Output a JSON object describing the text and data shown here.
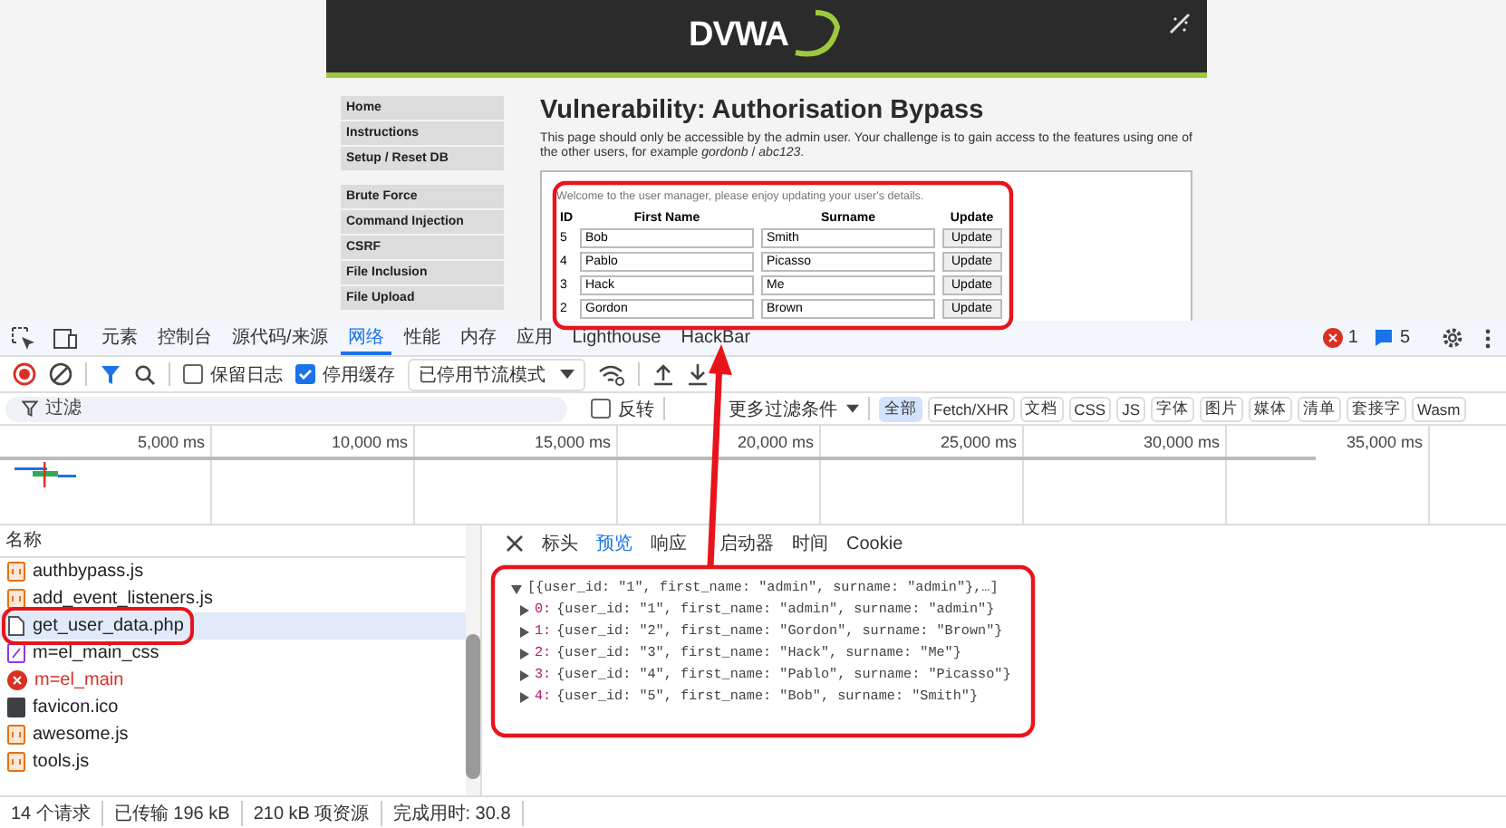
{
  "page": {
    "logo": "DVWA",
    "menu_groups": [
      [
        "Home",
        "Instructions",
        "Setup / Reset DB"
      ],
      [
        "Brute Force",
        "Command Injection",
        "CSRF",
        "File Inclusion",
        "File Upload"
      ]
    ],
    "heading": "Vulnerability: Authorisation Bypass",
    "intro": "This page should only be accessible by the admin user. Your challenge is to gain access to the features using one of the other users, for example *gordonb* / *abc123*.",
    "welcome": "Welcome to the user manager, please enjoy updating your user's details.",
    "columns": [
      "ID",
      "First Name",
      "Surname",
      "Update"
    ],
    "rows": [
      {
        "id": "5",
        "first_name": "Bob",
        "surname": "Smith",
        "button": "Update"
      },
      {
        "id": "4",
        "first_name": "Pablo",
        "surname": "Picasso",
        "button": "Update"
      },
      {
        "id": "3",
        "first_name": "Hack",
        "surname": "Me",
        "button": "Update"
      },
      {
        "id": "2",
        "first_name": "Gordon",
        "surname": "Brown",
        "button": "Update"
      }
    ]
  },
  "devtools": {
    "tabs": [
      {
        "label": "元素",
        "selected": false
      },
      {
        "label": "控制台",
        "selected": false
      },
      {
        "label": "源代码/来源",
        "selected": false
      },
      {
        "label": "网络",
        "selected": true
      },
      {
        "label": "性能",
        "selected": false
      },
      {
        "label": "内存",
        "selected": false
      },
      {
        "label": "应用",
        "selected": false
      },
      {
        "label": "Lighthouse",
        "selected": false
      },
      {
        "label": "HackBar",
        "selected": false
      }
    ],
    "errors": "1",
    "messages": "5",
    "checkboxes": [
      {
        "label": "保留日志",
        "checked": false
      },
      {
        "label": "停用缓存",
        "checked": true
      }
    ],
    "throttle": "已停用节流模式",
    "filter": {
      "placeholder": "过滤",
      "invert": {
        "label": "反转",
        "checked": false
      },
      "more": "更多过滤条件",
      "types": [
        {
          "label": "全部",
          "selected": true
        },
        {
          "label": "Fetch/XHR",
          "selected": false
        },
        {
          "label": "文档",
          "selected": false
        },
        {
          "label": "CSS",
          "selected": false
        },
        {
          "label": "JS",
          "selected": false
        },
        {
          "label": "字体",
          "selected": false
        },
        {
          "label": "图片",
          "selected": false
        },
        {
          "label": "媒体",
          "selected": false
        },
        {
          "label": "清单",
          "selected": false
        },
        {
          "label": "套接字",
          "selected": false
        },
        {
          "label": "Wasm",
          "selected": false
        }
      ]
    },
    "timeline_ticks": [
      "5,000 ms",
      "10,000 ms",
      "15,000 ms",
      "20,000 ms",
      "25,000 ms",
      "30,000 ms",
      "35,000 ms"
    ],
    "requests": {
      "header": "名称",
      "items": [
        {
          "name": "authbypass.js",
          "kind": "script",
          "selected": false
        },
        {
          "name": "add_event_listeners.js",
          "kind": "script",
          "selected": false
        },
        {
          "name": "get_user_data.php",
          "kind": "document",
          "selected": true
        },
        {
          "name": "m=el_main_css",
          "kind": "stylesheet",
          "selected": false
        },
        {
          "name": "m=el_main",
          "kind": "error",
          "selected": false
        },
        {
          "name": "favicon.ico",
          "kind": "image",
          "selected": false
        },
        {
          "name": "awesome.js",
          "kind": "script",
          "selected": false
        },
        {
          "name": "tools.js",
          "kind": "script",
          "selected": false
        }
      ]
    },
    "detail_tabs": [
      {
        "label": "标头",
        "selected": false
      },
      {
        "label": "预览",
        "selected": true
      },
      {
        "label": "响应",
        "selected": false
      },
      {
        "label": "启动器",
        "selected": false
      },
      {
        "label": "时间",
        "selected": false
      },
      {
        "label": "Cookie",
        "selected": false
      }
    ],
    "preview": {
      "summary": "[{user_id: \"1\", first_name: \"admin\", surname: \"admin\"},…]",
      "expanded": true,
      "items": [
        {
          "index": "0:",
          "text": "{user_id: \"1\", first_name: \"admin\", surname: \"admin\"}",
          "expanded": false
        },
        {
          "index": "1:",
          "text": "{user_id: \"2\", first_name: \"Gordon\", surname: \"Brown\"}",
          "expanded": false
        },
        {
          "index": "2:",
          "text": "{user_id: \"3\", first_name: \"Hack\", surname: \"Me\"}",
          "expanded": false
        },
        {
          "index": "3:",
          "text": "{user_id: \"4\", first_name: \"Pablo\", surname: \"Picasso\"}",
          "expanded": false
        },
        {
          "index": "4:",
          "text": "{user_id: \"5\", first_name: \"Bob\", surname: \"Smith\"}",
          "expanded": false
        }
      ]
    },
    "status": [
      "14 个请求",
      "已传输 196 kB",
      "210 kB 项资源",
      "完成用时: 30.8"
    ]
  }
}
